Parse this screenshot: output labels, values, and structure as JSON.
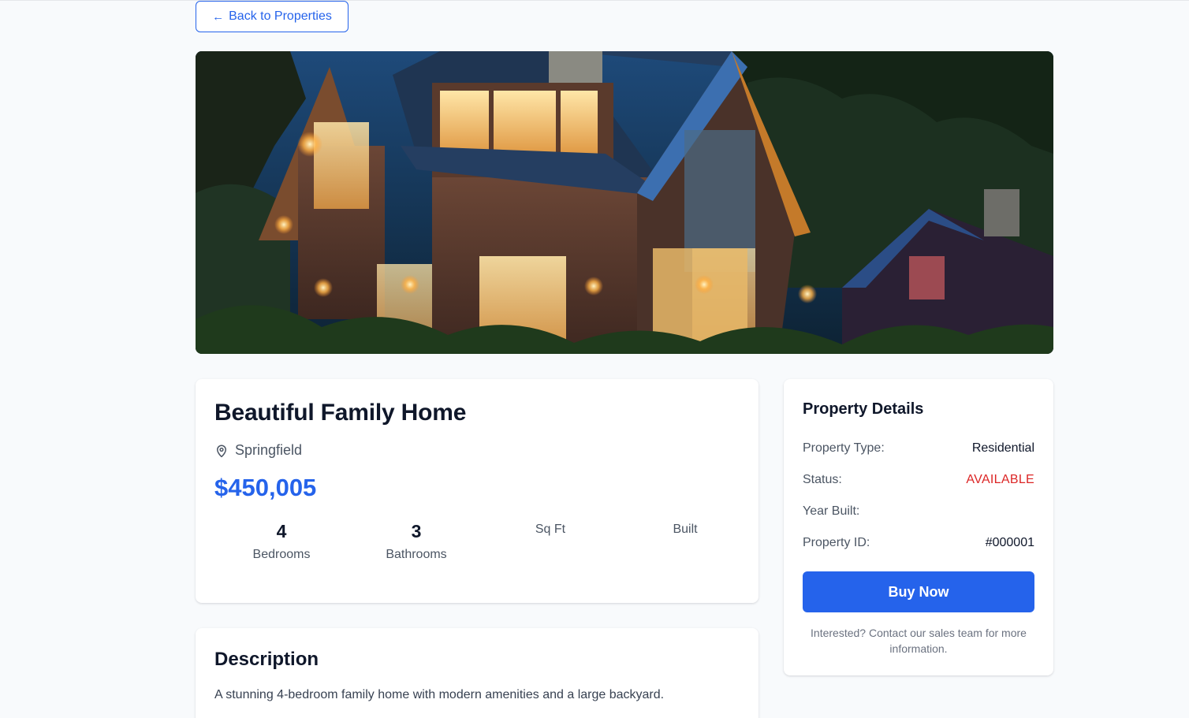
{
  "nav": {
    "back_label": "Back to Properties",
    "back_icon": "arrow-left-icon"
  },
  "hero": {
    "image": "house-photo-evening"
  },
  "property": {
    "title": "Beautiful Family Home",
    "location": "Springfield",
    "location_icon": "map-pin-icon",
    "price": "$450,005",
    "stats": [
      {
        "value": "4",
        "label": "Bedrooms"
      },
      {
        "value": "3",
        "label": "Bathrooms"
      },
      {
        "value": "",
        "label": "Sq Ft"
      },
      {
        "value": "",
        "label": "Built"
      }
    ]
  },
  "description": {
    "heading": "Description",
    "text": "A stunning 4-bedroom family home with modern amenities and a large backyard."
  },
  "details": {
    "heading": "Property Details",
    "rows": [
      {
        "key": "Property Type:",
        "value": "Residential"
      },
      {
        "key": "Status:",
        "value": "AVAILABLE"
      },
      {
        "key": "Year Built:",
        "value": ""
      },
      {
        "key": "Property ID:",
        "value": "#000001"
      }
    ],
    "buy_label": "Buy Now",
    "contact_note": "Interested? Contact our sales team for more information."
  },
  "colors": {
    "accent": "#2563eb",
    "status_available": "#dc2626",
    "background": "#f8fafc"
  }
}
